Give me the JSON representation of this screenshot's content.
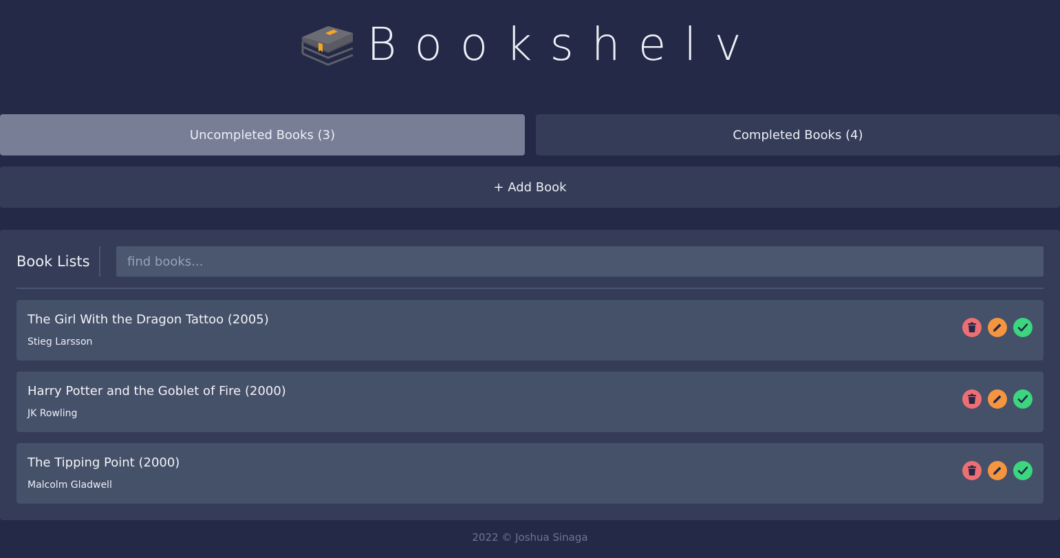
{
  "app": {
    "title": "Bookshelv"
  },
  "tabs": [
    {
      "label": "Uncompleted Books (3)",
      "active": true
    },
    {
      "label": "Completed Books (4)",
      "active": false
    }
  ],
  "add_book": {
    "label": "+ Add Book"
  },
  "book_list": {
    "title": "Book Lists",
    "search_placeholder": "find books...",
    "items": [
      {
        "title": "The Girl With the Dragon Tattoo (2005)",
        "author": "Stieg Larsson"
      },
      {
        "title": "Harry Potter and the Goblet of Fire (2000)",
        "author": "JK Rowling"
      },
      {
        "title": "The Tipping Point (2000)",
        "author": "Malcolm Gladwell"
      }
    ],
    "actions": [
      "trash-icon",
      "pencil-icon",
      "check-icon"
    ]
  },
  "footer": {
    "text": "2022 © Joshua Sinaga"
  },
  "colors": {
    "background": "#232946",
    "surface": "#343c57",
    "card": "#455069",
    "active_tab": "#787e95",
    "delete": "#ee6f73",
    "edit": "#f59540",
    "complete": "#3cd67f",
    "bookmark": "#f5a623"
  }
}
